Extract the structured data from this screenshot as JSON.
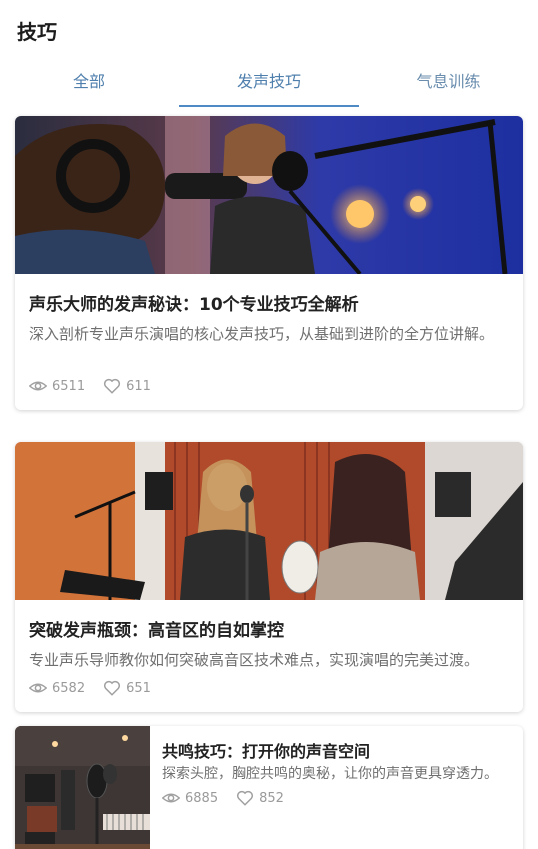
{
  "header": {
    "title": "技巧"
  },
  "tabs": [
    {
      "label": "全部"
    },
    {
      "label": "发声技巧"
    },
    {
      "label": "气息训练"
    }
  ],
  "articles": [
    {
      "title": "声乐大师的发声秘诀：10个专业技巧全解析",
      "description": "深入剖析专业声乐演唱的核心发声技巧，从基础到进阶的全方位讲解。",
      "views": "6511",
      "likes": "611"
    },
    {
      "title": "突破发声瓶颈：高音区的自如掌控",
      "description": "专业声乐导师教你如何突破高音区技术难点，实现演唱的完美过渡。",
      "views": "6582",
      "likes": "651"
    },
    {
      "title": "共鸣技巧：打开你的声音空间",
      "description": "探索头腔，胸腔共鸣的奥秘，让你的声音更具穿透力。",
      "views": "6885",
      "likes": "852"
    }
  ],
  "icons": {
    "views": "eye-icon",
    "likes": "heart-icon"
  }
}
